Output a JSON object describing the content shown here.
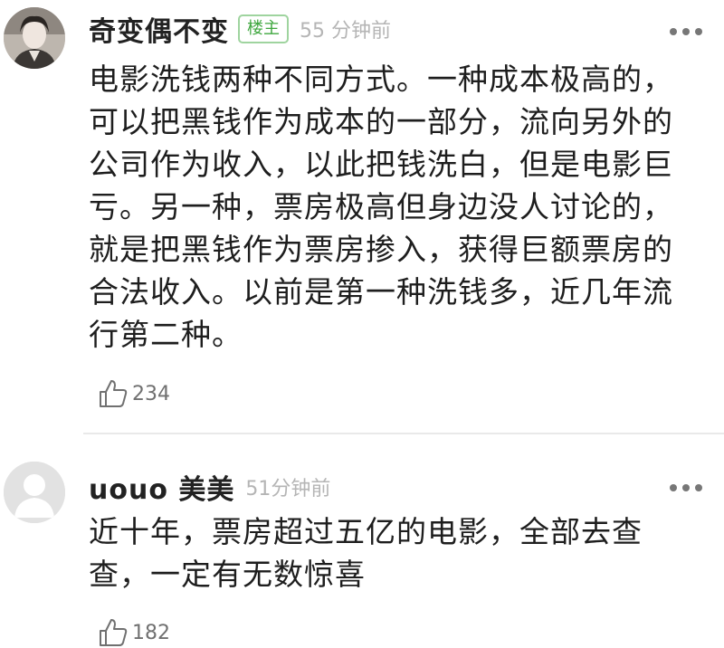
{
  "comments": [
    {
      "username": "奇变偶不变",
      "badge": "楼主",
      "time": "55 分钟前",
      "text": "电影洗钱两种不同方式。一种成本极高的，\n可以把黑钱作为成本的一部分，流向另外的\n公司作为收入，以此把钱洗白，但是电影巨\n亏。另一种，票房极高但身边没人讨论的，\n就是把黑钱作为票房掺入，获得巨额票房的\n合法收入。以前是第一种洗钱多，近几年流\n行第二种。",
      "likes": "234",
      "more_icon": "more-dots-icon",
      "like_icon": "thumbs-up-icon"
    },
    {
      "username": "uouo 美美",
      "time": "51分钟前",
      "text": "近十年，票房超过五亿的电影，全部去查\n查，一定有无数惊喜",
      "likes": "182",
      "more_icon": "more-dots-icon",
      "like_icon": "thumbs-up-icon"
    }
  ],
  "colors": {
    "badge_green": "#3fa73f",
    "time_gray": "#b5b5b5",
    "text_dark": "#1e1e1e"
  }
}
